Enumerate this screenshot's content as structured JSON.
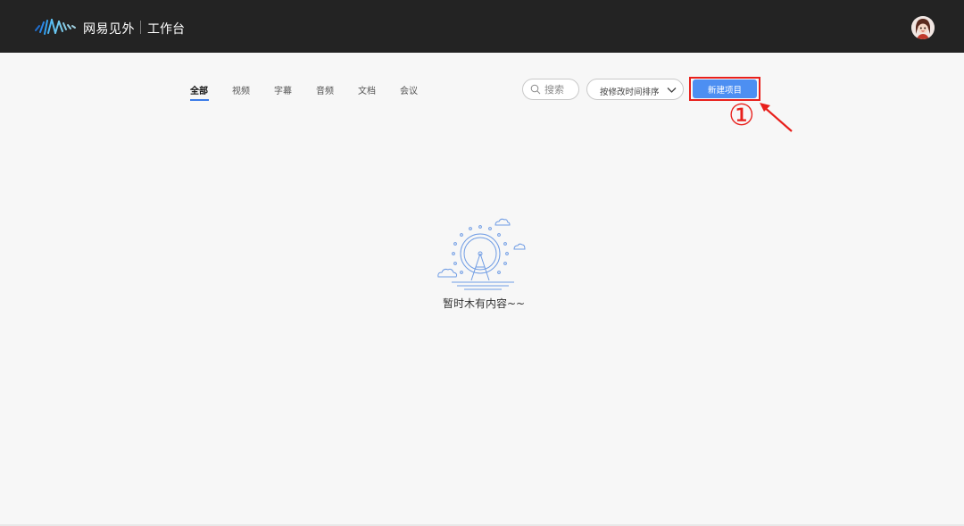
{
  "header": {
    "brand": "网易见外",
    "subtitle": "工作台",
    "logo_icon": "waveform-logo-icon",
    "avatar_icon": "user-avatar-icon"
  },
  "tabs": [
    {
      "label": "全部",
      "active": true
    },
    {
      "label": "视频",
      "active": false
    },
    {
      "label": "字幕",
      "active": false
    },
    {
      "label": "音频",
      "active": false
    },
    {
      "label": "文档",
      "active": false
    },
    {
      "label": "会议",
      "active": false
    }
  ],
  "search": {
    "placeholder": "搜索",
    "icon": "search-icon"
  },
  "sort": {
    "label": "按修改时间排序",
    "icon": "chevron-down-icon"
  },
  "new_project": {
    "label": "新建项目"
  },
  "annotation": {
    "marker": "①",
    "color": "#e8201c"
  },
  "empty_state": {
    "text": "暂时木有内容~~",
    "icon": "ferris-wheel-icon"
  },
  "colors": {
    "topbar": "#232323",
    "accent": "#4d8ff2",
    "tab_underline": "#3c7ce8"
  }
}
